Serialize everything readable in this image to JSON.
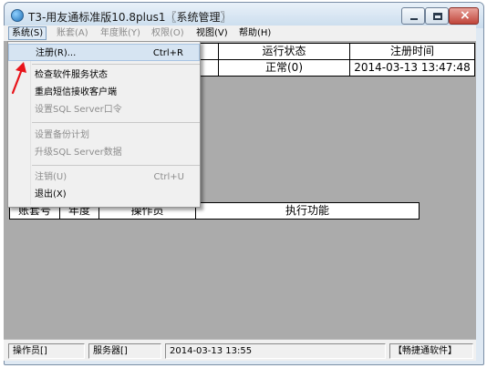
{
  "window": {
    "title": "T3-用友通标准版10.8plus1〖系统管理〗"
  },
  "menubar": {
    "items": [
      {
        "label": "系统(S)",
        "enabled": true
      },
      {
        "label": "账套(A)",
        "enabled": false
      },
      {
        "label": "年度账(Y)",
        "enabled": false
      },
      {
        "label": "权限(O)",
        "enabled": false
      },
      {
        "label": "视图(V)",
        "enabled": true
      },
      {
        "label": "帮助(H)",
        "enabled": true
      }
    ]
  },
  "system_menu": {
    "items": [
      {
        "label": "注册(R)...",
        "shortcut": "Ctrl+R",
        "enabled": true,
        "highlighted": true
      },
      {
        "label": "检查软件服务状态",
        "shortcut": "",
        "enabled": true
      },
      {
        "label": "重启短信接收客户端",
        "shortcut": "",
        "enabled": true
      },
      {
        "label": "设置SQL Server口令",
        "shortcut": "",
        "enabled": false
      },
      {
        "label": "设置备份计划",
        "shortcut": "",
        "enabled": false
      },
      {
        "label": "升级SQL Server数据",
        "shortcut": "",
        "enabled": false
      },
      {
        "label": "注销(U)",
        "shortcut": "Ctrl+U",
        "enabled": false
      },
      {
        "label": "退出(X)",
        "shortcut": "",
        "enabled": true
      }
    ]
  },
  "top_table": {
    "columns": [
      "运行状态",
      "注册时间"
    ],
    "rows": [
      [
        "正常(0)",
        "2014-03-13 13:47:48"
      ]
    ]
  },
  "bottom_table": {
    "columns": [
      "账套号",
      "年度",
      "操作员",
      "执行功能"
    ]
  },
  "statusbar": {
    "operator": "操作员[]",
    "server": "服务器[]",
    "datetime": "2014-03-13 13:55",
    "brand": "【畅捷通软件】"
  },
  "colors": {
    "annotation_arrow": "#e8141a",
    "client_background": "#ababab"
  }
}
